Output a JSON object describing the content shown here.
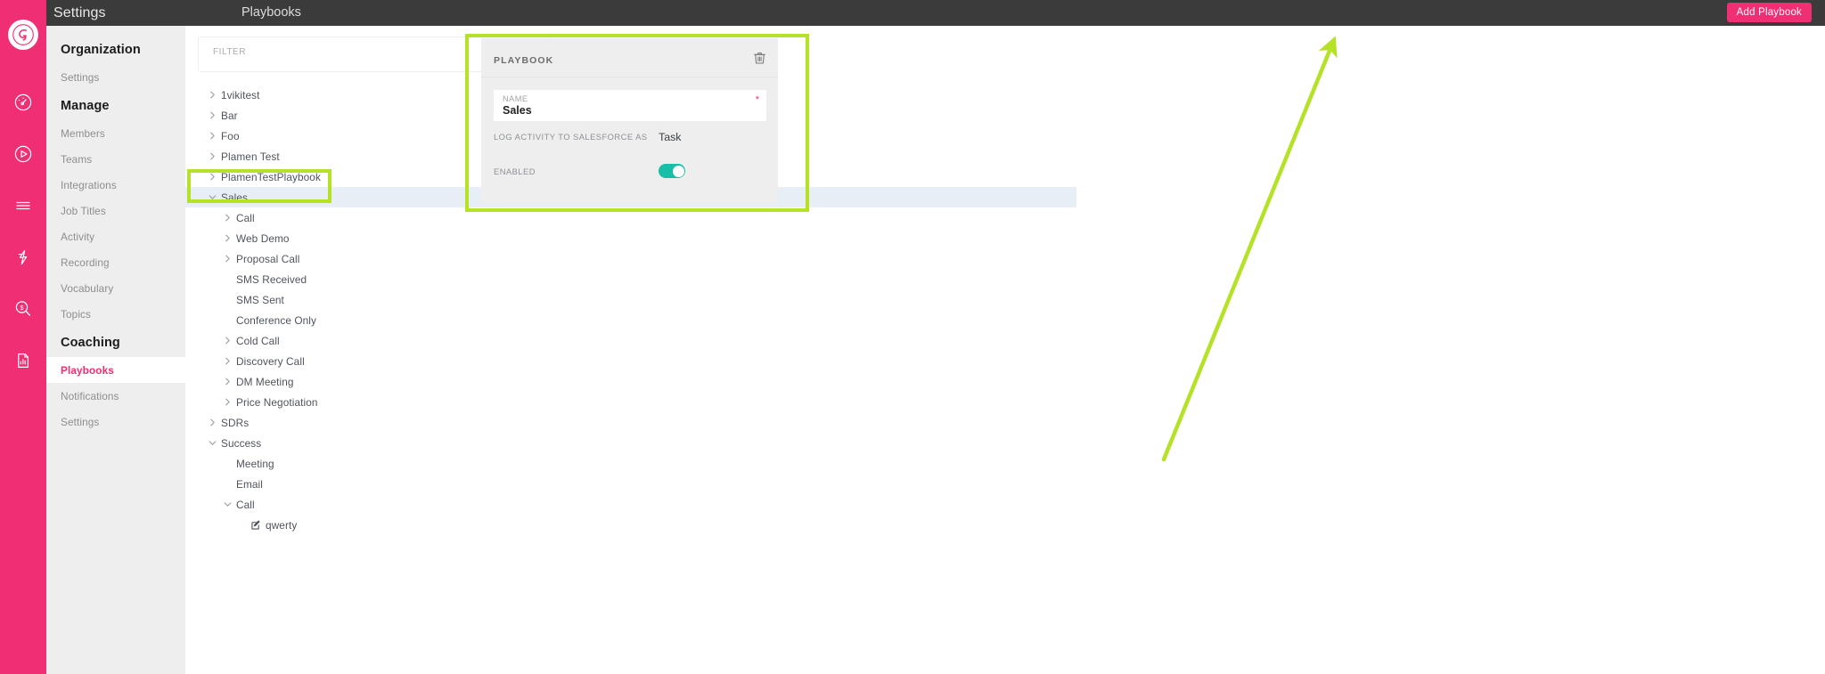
{
  "brand": {
    "accent": "#ef2e73",
    "annotation": "#b5e227",
    "toggle_on": "#18bfa6"
  },
  "topbar": {
    "settings_label": "Settings",
    "page_title": "Playbooks",
    "add_playbook_label": "Add Playbook"
  },
  "sidebar": {
    "groups": [
      {
        "title": "Organization",
        "items": [
          {
            "label": "Settings",
            "active": false
          }
        ]
      },
      {
        "title": "Manage",
        "items": [
          {
            "label": "Members",
            "active": false
          },
          {
            "label": "Teams",
            "active": false
          },
          {
            "label": "Integrations",
            "active": false
          },
          {
            "label": "Job Titles",
            "active": false
          },
          {
            "label": "Activity",
            "active": false
          },
          {
            "label": "Recording",
            "active": false
          },
          {
            "label": "Vocabulary",
            "active": false
          },
          {
            "label": "Topics",
            "active": false
          }
        ]
      },
      {
        "title": "Coaching",
        "items": [
          {
            "label": "Playbooks",
            "active": true
          },
          {
            "label": "Notifications",
            "active": false
          },
          {
            "label": "Settings",
            "active": false
          }
        ]
      }
    ]
  },
  "rail": {
    "logo": "gong-logo-icon",
    "icons": [
      "dashboard-gauge-icon",
      "play-circle-icon",
      "list-lines-icon",
      "lightning-bolt-icon",
      "deal-search-icon",
      "report-document-icon"
    ]
  },
  "filter": {
    "placeholder": "FILTER",
    "value": ""
  },
  "tree": {
    "rows": [
      {
        "label": "1vikitest",
        "depth": 0,
        "toggle": "collapsed",
        "selected": false
      },
      {
        "label": "Bar",
        "depth": 0,
        "toggle": "collapsed",
        "selected": false
      },
      {
        "label": "Foo",
        "depth": 0,
        "toggle": "collapsed",
        "selected": false
      },
      {
        "label": "Plamen Test",
        "depth": 0,
        "toggle": "collapsed",
        "selected": false
      },
      {
        "label": "PlamenTestPlaybook",
        "depth": 0,
        "toggle": "collapsed",
        "selected": false
      },
      {
        "label": "Sales",
        "depth": 0,
        "toggle": "expanded",
        "selected": true
      },
      {
        "label": "Call",
        "depth": 1,
        "toggle": "collapsed",
        "selected": false
      },
      {
        "label": "Web Demo",
        "depth": 1,
        "toggle": "collapsed",
        "selected": false
      },
      {
        "label": "Proposal Call",
        "depth": 1,
        "toggle": "collapsed",
        "selected": false
      },
      {
        "label": "SMS Received",
        "depth": 1,
        "toggle": "none",
        "selected": false
      },
      {
        "label": "SMS Sent",
        "depth": 1,
        "toggle": "none",
        "selected": false
      },
      {
        "label": "Conference Only",
        "depth": 1,
        "toggle": "none",
        "selected": false
      },
      {
        "label": "Cold Call",
        "depth": 1,
        "toggle": "collapsed",
        "selected": false
      },
      {
        "label": "Discovery Call",
        "depth": 1,
        "toggle": "collapsed",
        "selected": false
      },
      {
        "label": "DM Meeting",
        "depth": 1,
        "toggle": "collapsed",
        "selected": false
      },
      {
        "label": "Price Negotiation",
        "depth": 1,
        "toggle": "collapsed",
        "selected": false
      },
      {
        "label": "SDRs",
        "depth": 0,
        "toggle": "collapsed",
        "selected": false
      },
      {
        "label": "Success",
        "depth": 0,
        "toggle": "expanded",
        "selected": false
      },
      {
        "label": "Meeting",
        "depth": 1,
        "toggle": "none",
        "selected": false
      },
      {
        "label": "Email",
        "depth": 1,
        "toggle": "none",
        "selected": false
      },
      {
        "label": "Call",
        "depth": 1,
        "toggle": "expanded",
        "selected": false
      },
      {
        "label": "qwerty",
        "depth": 2,
        "toggle": "none",
        "selected": false,
        "icon": "edit-pencil-icon"
      }
    ]
  },
  "detail": {
    "header": "PLAYBOOK",
    "delete_icon": "trash-icon",
    "name_label": "NAME",
    "name_value": "Sales",
    "required_marker": "*",
    "log_activity_label": "LOG ACTIVITY TO SALESFORCE AS",
    "log_activity_value": "Task",
    "enabled_label": "ENABLED",
    "enabled_value": "on"
  },
  "annotations": {
    "sales_row_box": "highlight-box-sales-row",
    "detail_panel_box": "highlight-box-playbook-panel",
    "arrow": "pointer-arrow-to-add-playbook"
  }
}
